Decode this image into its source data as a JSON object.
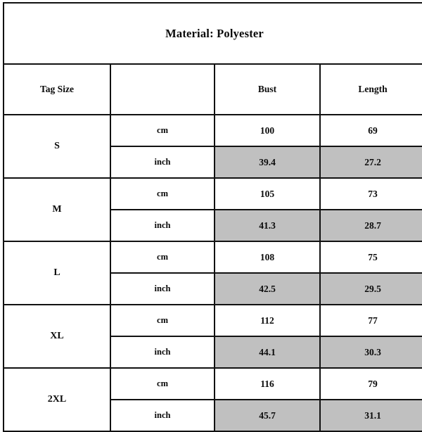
{
  "title": "Material: Polyester",
  "columns": {
    "tag_size": "Tag Size",
    "unit": "",
    "bust": "Bust",
    "length": "Length"
  },
  "units": {
    "cm": "cm",
    "inch": "inch"
  },
  "colors": {
    "shaded_cell": "#c0c0c0",
    "border": "#111111",
    "background": "#ffffff",
    "text": "#0a0a0a"
  },
  "chart_data": {
    "type": "table",
    "title": "Material: Polyester",
    "columns": [
      "Tag Size",
      "",
      "Bust",
      "Length"
    ],
    "rows": [
      {
        "size": "S",
        "unit": "cm",
        "bust": "100",
        "length": "69",
        "shaded": false
      },
      {
        "size": "S",
        "unit": "inch",
        "bust": "39.4",
        "length": "27.2",
        "shaded": true
      },
      {
        "size": "M",
        "unit": "cm",
        "bust": "105",
        "length": "73",
        "shaded": false
      },
      {
        "size": "M",
        "unit": "inch",
        "bust": "41.3",
        "length": "28.7",
        "shaded": true
      },
      {
        "size": "L",
        "unit": "cm",
        "bust": "108",
        "length": "75",
        "shaded": false
      },
      {
        "size": "L",
        "unit": "inch",
        "bust": "42.5",
        "length": "29.5",
        "shaded": true
      },
      {
        "size": "XL",
        "unit": "cm",
        "bust": "112",
        "length": "77",
        "shaded": false
      },
      {
        "size": "XL",
        "unit": "inch",
        "bust": "44.1",
        "length": "30.3",
        "shaded": true
      },
      {
        "size": "2XL",
        "unit": "cm",
        "bust": "116",
        "length": "79",
        "shaded": false
      },
      {
        "size": "2XL",
        "unit": "inch",
        "bust": "45.7",
        "length": "31.1",
        "shaded": true
      }
    ]
  },
  "groups": [
    {
      "size": "S",
      "cm": {
        "bust": "100",
        "length": "69"
      },
      "inch": {
        "bust": "39.4",
        "length": "27.2"
      }
    },
    {
      "size": "M",
      "cm": {
        "bust": "105",
        "length": "73"
      },
      "inch": {
        "bust": "41.3",
        "length": "28.7"
      }
    },
    {
      "size": "L",
      "cm": {
        "bust": "108",
        "length": "75"
      },
      "inch": {
        "bust": "42.5",
        "length": "29.5"
      }
    },
    {
      "size": "XL",
      "cm": {
        "bust": "112",
        "length": "77"
      },
      "inch": {
        "bust": "44.1",
        "length": "30.3"
      }
    },
    {
      "size": "2XL",
      "cm": {
        "bust": "116",
        "length": "79"
      },
      "inch": {
        "bust": "45.7",
        "length": "31.1"
      }
    }
  ]
}
